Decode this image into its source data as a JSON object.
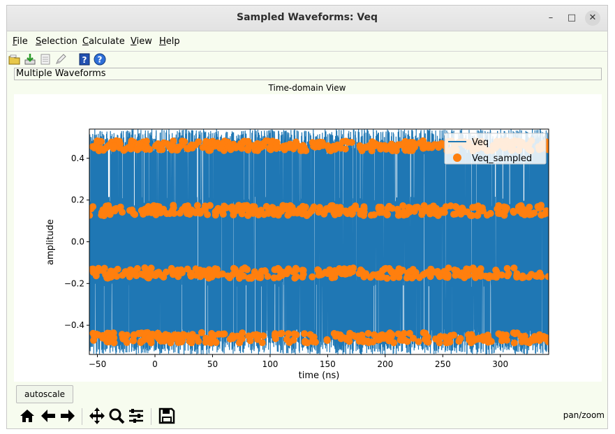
{
  "window": {
    "title": "Sampled Waveforms: Veq"
  },
  "window_controls": {
    "minimize": "–",
    "maximize": "□",
    "close": "✕"
  },
  "menu": [
    {
      "key": "F",
      "rest": "ile"
    },
    {
      "key": "S",
      "rest": "election"
    },
    {
      "key": "C",
      "rest": "alculate"
    },
    {
      "key": "V",
      "rest": "iew"
    },
    {
      "key": "H",
      "rest": "elp"
    }
  ],
  "toolbar_icons": [
    "open-folder-icon",
    "download-icon",
    "list-icon",
    "edit-icon",
    "help-book-icon",
    "help-circle-icon"
  ],
  "panel": {
    "label": "Multiple Waveforms"
  },
  "view": {
    "title": "Time-domain View"
  },
  "chart_data": {
    "type": "line",
    "xlabel": "time (ns)",
    "ylabel": "amplitude",
    "xlim": [
      -57,
      342
    ],
    "ylim": [
      -0.54,
      0.54
    ],
    "x_ticks": [
      "−50",
      "0",
      "50",
      "100",
      "150",
      "200",
      "250",
      "300"
    ],
    "x_tick_values": [
      -50,
      0,
      50,
      100,
      150,
      200,
      250,
      300
    ],
    "y_ticks": [
      "0.4",
      "0.2",
      "0.0",
      "−0.2",
      "−0.4"
    ],
    "y_tick_values": [
      0.4,
      0.2,
      0.0,
      -0.2,
      -0.4
    ],
    "legend_placement": "top-right",
    "series": [
      {
        "name": "Veq",
        "kind": "line",
        "color": "#1f77b4",
        "range": [
          -0.54,
          0.54
        ]
      },
      {
        "name": "Veq_sampled",
        "kind": "scatter",
        "color": "#ff7f0e",
        "levels": [
          0.46,
          0.15,
          -0.15,
          -0.46
        ]
      }
    ]
  },
  "buttons": {
    "autoscale": "autoscale"
  },
  "nav_icons": [
    "home-icon",
    "back-arrow-icon",
    "forward-arrow-icon",
    "pan-icon",
    "zoom-icon",
    "configure-icon",
    "save-icon"
  ],
  "status": {
    "mode": "pan/zoom"
  }
}
